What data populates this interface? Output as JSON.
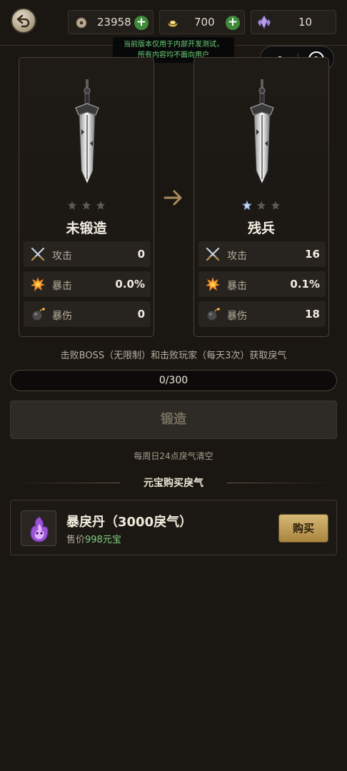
{
  "currencies": [
    {
      "icon": "coin-icon",
      "value": "23958"
    },
    {
      "icon": "ingot-icon",
      "value": "700"
    },
    {
      "icon": "crystal-icon",
      "value": "10"
    }
  ],
  "notice": {
    "line1": "当前版本仅用于内部开发测试，",
    "line2": "所有内容均不面向用户"
  },
  "panels": {
    "current": {
      "tier": "未锻造",
      "stars_lit": 0,
      "stats": [
        {
          "name": "攻击",
          "value": "0",
          "icon": "swords-icon"
        },
        {
          "name": "暴击",
          "value": "0.0%",
          "icon": "burst-icon"
        },
        {
          "name": "暴伤",
          "value": "0",
          "icon": "bomb-icon"
        }
      ]
    },
    "next": {
      "tier": "残兵",
      "stars_lit": 1,
      "stats": [
        {
          "name": "攻击",
          "value": "16",
          "icon": "swords-icon"
        },
        {
          "name": "暴击",
          "value": "0.1%",
          "icon": "burst-icon"
        },
        {
          "name": "暴伤",
          "value": "18",
          "icon": "bomb-icon"
        }
      ]
    }
  },
  "hint": "击败BOSS（无限制）和击败玩家（每天3次）获取戾气",
  "progress": {
    "text": "0/300",
    "fraction": 0
  },
  "forge_button": "锻造",
  "clear_note": "每周日24点戾气清空",
  "shop": {
    "title": "元宝购买戾气",
    "item": {
      "name": "暴戾丹（3000戾气）",
      "price_prefix": "售价",
      "price_value": "998元宝",
      "buy_label": "购买"
    }
  },
  "colors": {
    "background": "#1a1612",
    "accent_gold": "#c9a75f",
    "price_green": "#7fd27d",
    "notice_green": "#69d17a"
  }
}
